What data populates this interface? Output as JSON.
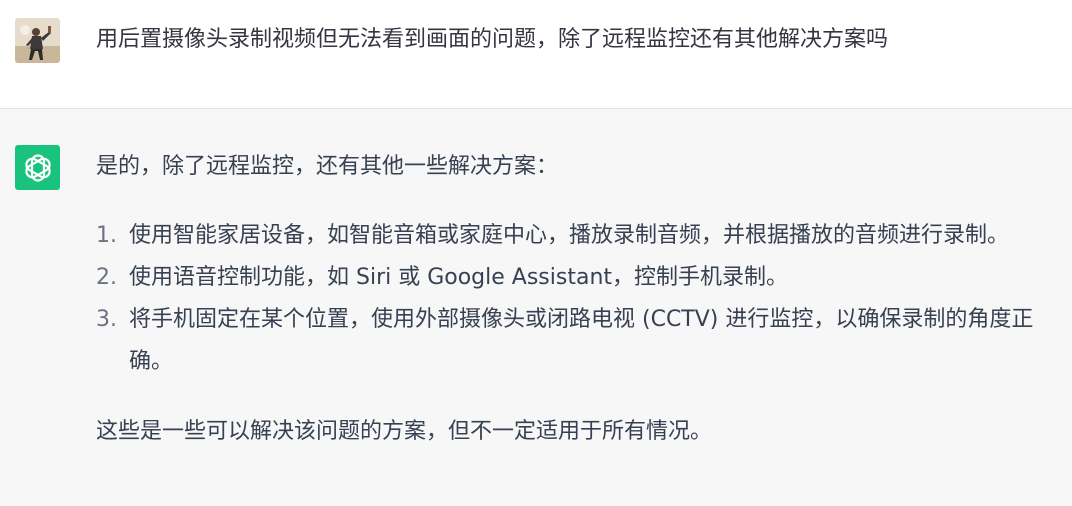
{
  "conversation": {
    "user_message": {
      "avatar": "user-photo",
      "text": "用后置摄像头录制视频但无法看到画面的问题，除了远程监控还有其他解决方案吗"
    },
    "assistant_message": {
      "avatar": "openai-logo-icon",
      "avatar_color": "#19c37d",
      "intro": "是的，除了远程监控，还有其他一些解决方案：",
      "items": [
        {
          "num": "1.",
          "text": "使用智能家居设备，如智能音箱或家庭中心，播放录制音频，并根据播放的音频进行录制。"
        },
        {
          "num": "2.",
          "text": "使用语音控制功能，如 Siri 或 Google Assistant，控制手机录制。"
        },
        {
          "num": "3.",
          "text": "将手机固定在某个位置，使用外部摄像头或闭路电视 (CCTV) 进行监控，以确保录制的角度正确。"
        }
      ],
      "outro": "这些是一些可以解决该问题的方案，但不一定适用于所有情况。"
    }
  }
}
